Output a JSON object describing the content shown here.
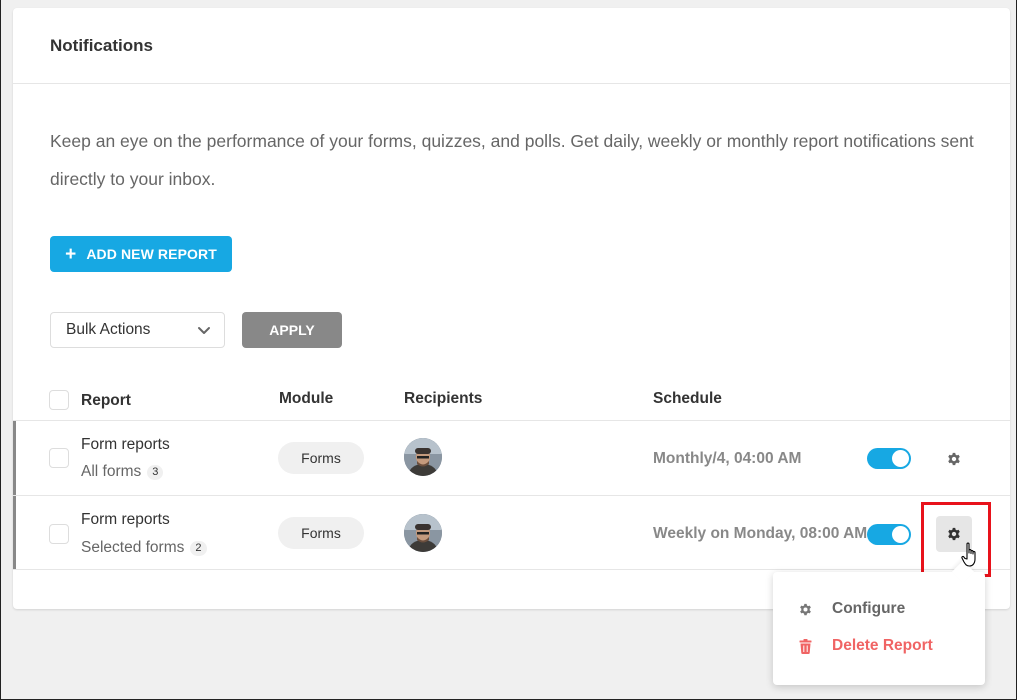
{
  "header": {
    "title": "Notifications"
  },
  "description": "Keep an eye on the performance of your forms, quizzes, and polls. Get daily, weekly or monthly report notifications sent directly to your inbox.",
  "add_button": {
    "label": "ADD NEW REPORT",
    "icon": "plus-icon"
  },
  "bulk_actions": {
    "selected": "Bulk Actions",
    "apply_label": "APPLY"
  },
  "table": {
    "columns": [
      "Report",
      "Module",
      "Recipients",
      "Schedule"
    ],
    "rows": [
      {
        "title": "Form reports",
        "subtitle": "All forms",
        "count": "3",
        "module": "Forms",
        "schedule": "Monthly/4, 04:00 AM",
        "enabled": true
      },
      {
        "title": "Form reports",
        "subtitle": "Selected forms",
        "count": "2",
        "module": "Forms",
        "schedule": "Weekly on Monday, 08:00 AM",
        "enabled": true
      }
    ]
  },
  "menu": {
    "items": [
      {
        "label": "Configure",
        "icon": "gear-icon"
      },
      {
        "label": "Delete Report",
        "icon": "trash-icon"
      }
    ]
  },
  "colors": {
    "accent": "#17a8e3",
    "apply_button": "#888888",
    "delete": "#f06464",
    "highlight": "#e8121b"
  }
}
